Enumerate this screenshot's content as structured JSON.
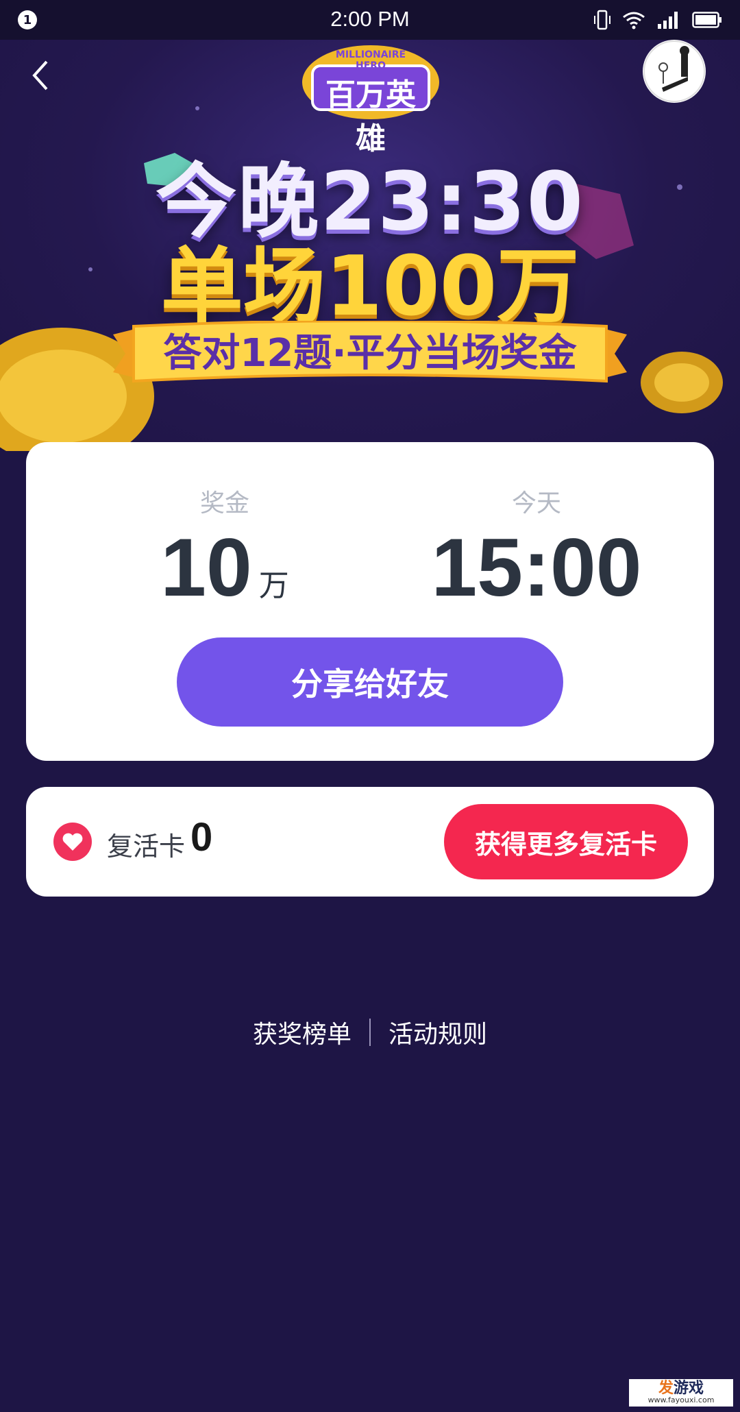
{
  "status_bar": {
    "notification_count": "1",
    "time": "2:00 PM",
    "icons": [
      "vibrate-icon",
      "wifi-icon",
      "signal-icon",
      "battery-icon"
    ]
  },
  "header": {
    "back_icon": "chevron-left-icon",
    "logo_text_cn": "百万英雄",
    "logo_text_en": "MILLIONAIRE HERO"
  },
  "hero": {
    "headline_line1": "今晚23:30",
    "headline_line2": "单场100万",
    "ribbon_text": "答对12题·平分当场奖金"
  },
  "main_card": {
    "prize_label": "奖金",
    "prize_value": "10",
    "prize_unit": "万",
    "time_label": "今天",
    "time_value": "15:00",
    "share_button": "分享给好友"
  },
  "revive_card": {
    "label": "复活卡",
    "count": "0",
    "button": "获得更多复活卡"
  },
  "links": {
    "winners": "获奖榜单",
    "rules": "活动规则"
  },
  "watermark": {
    "main_accent": "发",
    "main_rest": "游戏",
    "sub": "www.fayouxi.com"
  },
  "colors": {
    "background": "#1e1545",
    "share_button": "#7354ea",
    "revive_button": "#f4274f",
    "headline_gold": "#ffd43a"
  }
}
